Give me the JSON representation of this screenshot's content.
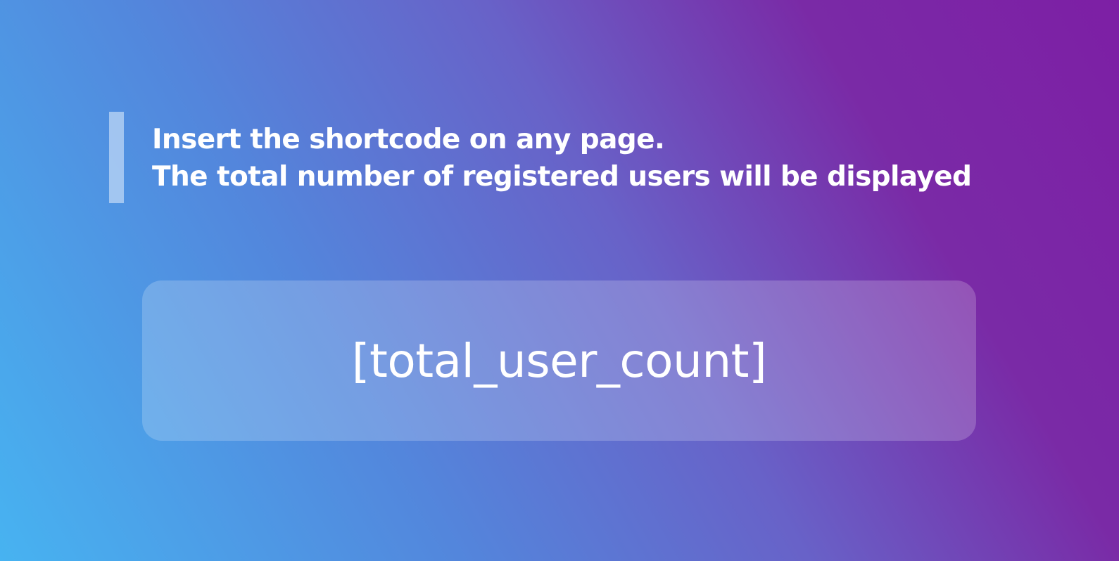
{
  "instructions": {
    "line1": "Insert the shortcode on any page.",
    "line2": "The total number of registered users will be displayed"
  },
  "shortcode": {
    "text": "[total_user_count]"
  },
  "colors": {
    "gradient_start": "#47b3f1",
    "gradient_mid": "#6862c8",
    "gradient_end": "#7d1fa5",
    "accent_bar": "#bed7f5",
    "text": "#ffffff"
  }
}
